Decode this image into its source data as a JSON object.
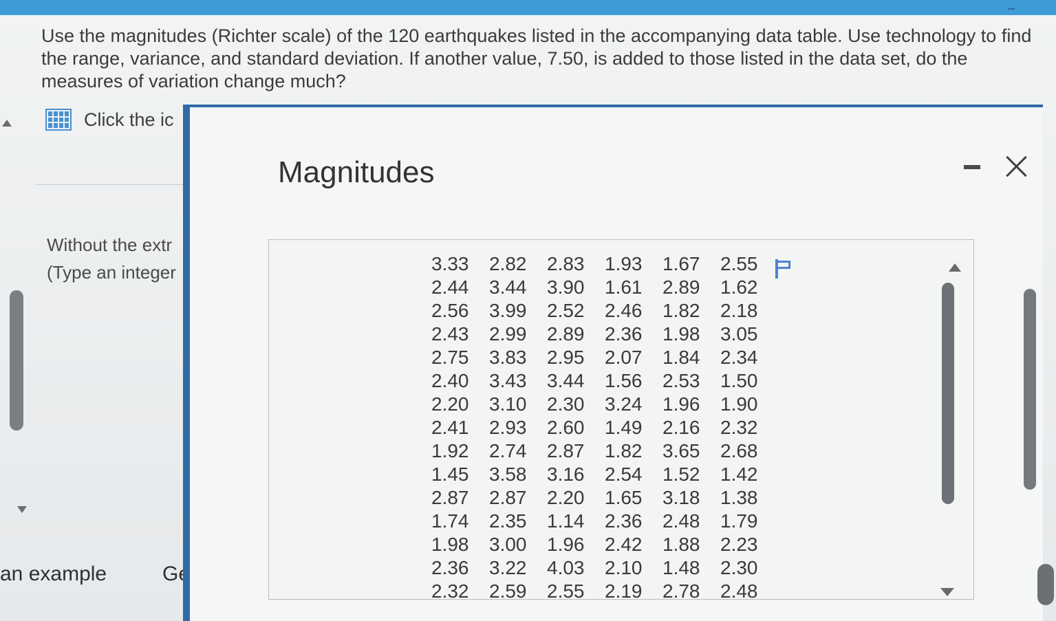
{
  "question": {
    "text": "Use the magnitudes (Richter scale) of the 120 earthquakes listed in the accompanying data table. Use technology to find the range, variance, and standard deviation. If another value, 7.50, is added to those listed in the data set, do the measures of variation change much?"
  },
  "left": {
    "click_text": "Click the ic",
    "without_line1": "Without the extr",
    "without_line2": "(Type an integer",
    "bottom_example": "an example",
    "bottom_ge": "Ge"
  },
  "dialog": {
    "title": "Magnitudes",
    "rows": [
      [
        "3.33",
        "2.82",
        "2.83",
        "1.93",
        "1.67",
        "2.55"
      ],
      [
        "2.44",
        "3.44",
        "3.90",
        "1.61",
        "2.89",
        "1.62"
      ],
      [
        "2.56",
        "3.99",
        "2.52",
        "2.46",
        "1.82",
        "2.18"
      ],
      [
        "2.43",
        "2.99",
        "2.89",
        "2.36",
        "1.98",
        "3.05"
      ],
      [
        "2.75",
        "3.83",
        "2.95",
        "2.07",
        "1.84",
        "2.34"
      ],
      [
        "2.40",
        "3.43",
        "3.44",
        "1.56",
        "2.53",
        "1.50"
      ],
      [
        "2.20",
        "3.10",
        "2.30",
        "3.24",
        "1.96",
        "1.90"
      ],
      [
        "2.41",
        "2.93",
        "2.60",
        "1.49",
        "2.16",
        "2.32"
      ],
      [
        "1.92",
        "2.74",
        "2.87",
        "1.82",
        "3.65",
        "2.68"
      ],
      [
        "1.45",
        "3.58",
        "3.16",
        "2.54",
        "1.52",
        "1.42"
      ],
      [
        "2.87",
        "2.87",
        "2.20",
        "1.65",
        "3.18",
        "1.38"
      ],
      [
        "1.74",
        "2.35",
        "1.14",
        "2.36",
        "2.48",
        "1.79"
      ],
      [
        "1.98",
        "3.00",
        "1.96",
        "2.42",
        "1.88",
        "2.23"
      ],
      [
        "2.36",
        "3.22",
        "4.03",
        "2.10",
        "1.48",
        "2.30"
      ],
      [
        "2.32",
        "2.59",
        "2.55",
        "2.19",
        "2.78",
        "2.48"
      ]
    ]
  },
  "colors": {
    "top_bar": "#3f9bd6",
    "dialog_border": "#2f6aa6",
    "icon_blue": "#4a8fd0"
  },
  "icons": [
    "table-grid-icon",
    "flag-icon",
    "minimize-icon",
    "close-icon",
    "scroll-up-arrow",
    "scroll-down-arrow"
  ]
}
